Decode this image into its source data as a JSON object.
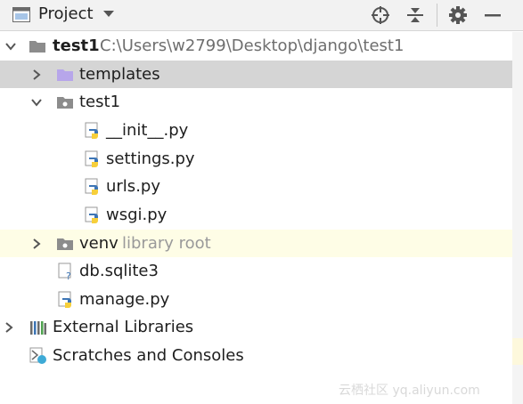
{
  "toolbar": {
    "title": "Project",
    "icons": [
      "window-icon",
      "dropdown-chevron-icon",
      "crosshair-icon",
      "collapse-all-icon",
      "gear-icon",
      "minimize-icon"
    ]
  },
  "tree": {
    "root": {
      "label": "test1",
      "path": "C:\\Users\\w2799\\Desktop\\django\\test1"
    },
    "templates": {
      "label": "templates"
    },
    "pkg": {
      "label": "test1"
    },
    "files": [
      {
        "label": "__init__.py"
      },
      {
        "label": "settings.py"
      },
      {
        "label": "urls.py"
      },
      {
        "label": "wsgi.py"
      }
    ],
    "venv": {
      "label": "venv",
      "hint": "library root"
    },
    "db": {
      "label": "db.sqlite3"
    },
    "manage": {
      "label": "manage.py"
    },
    "external": {
      "label": "External Libraries"
    },
    "scratches": {
      "label": "Scratches and Consoles"
    }
  },
  "watermark": "云栖社区 yq.aliyun.com",
  "colors": {
    "selected_row": "#d5d5d5",
    "library_row": "#fefde6",
    "folder_purple": "#b7a6ea",
    "folder_gray": "#8c8c8c",
    "python_blue": "#3d75b5",
    "python_yellow": "#f7cf3a"
  }
}
